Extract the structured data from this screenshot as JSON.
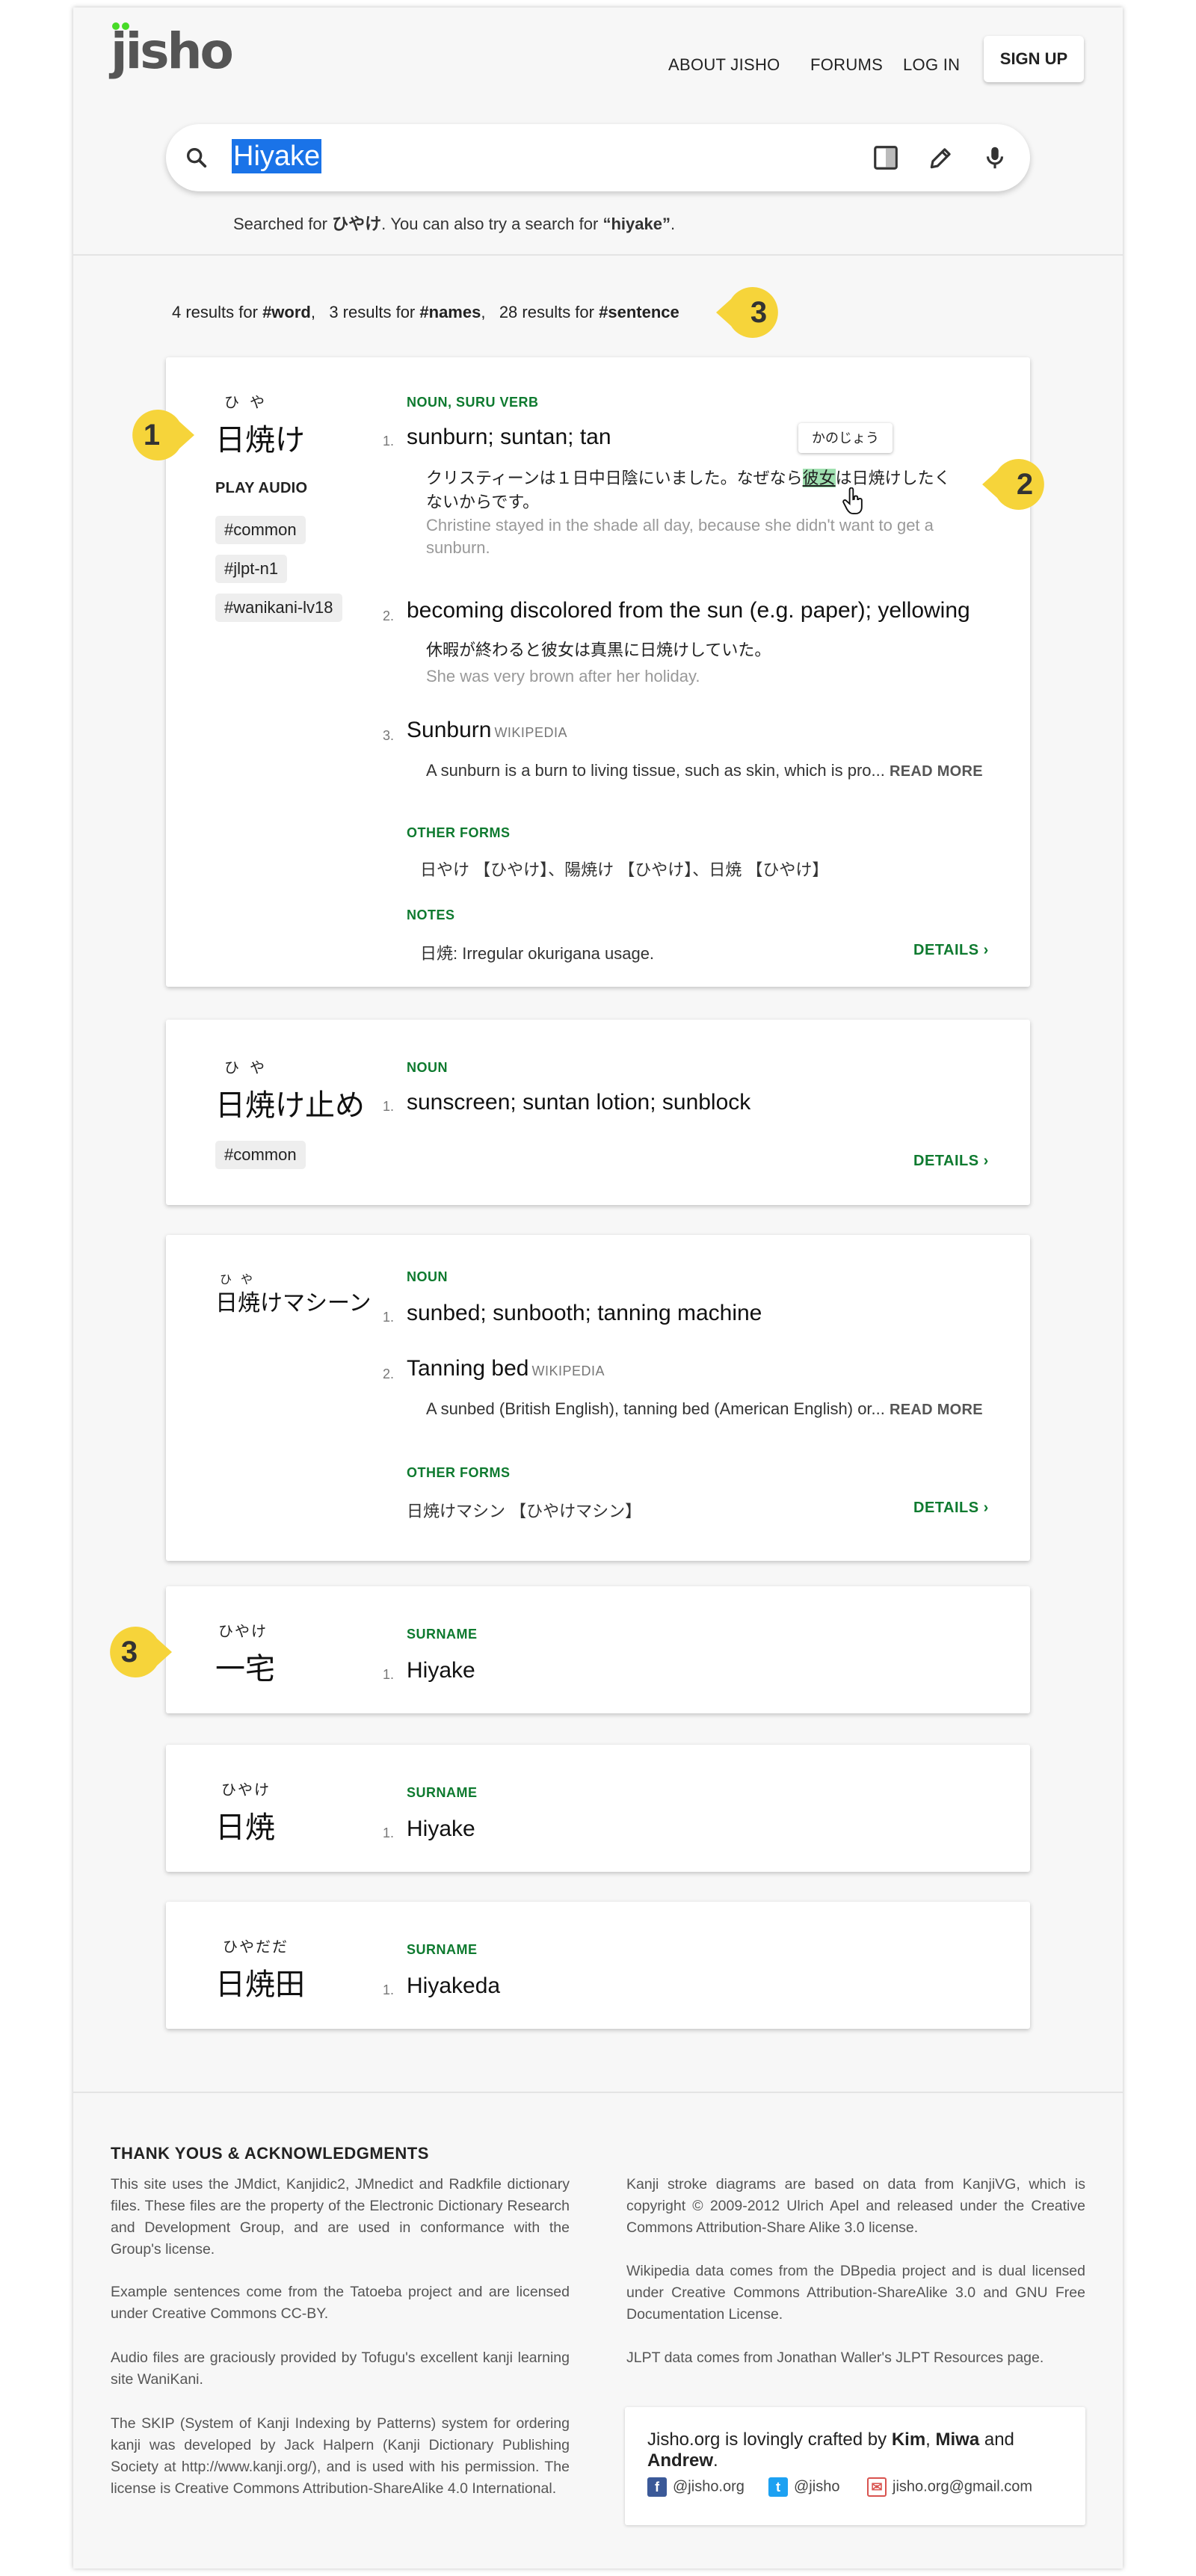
{
  "header": {
    "logo": "jisho",
    "nav": [
      "About Jisho",
      "Forums",
      "Log in"
    ],
    "signup": "SIGN UP"
  },
  "search": {
    "value": "Hiyake",
    "searched_prefix": "Searched for ",
    "searched_kana": "ひやけ",
    "searched_mid": ". You can also try a search for ",
    "searched_alt": "“hiyake”",
    "searched_end": "."
  },
  "results": {
    "word_count": "4 results for",
    "word_tag": "#word",
    "names_count": "3 results for",
    "names_tag": "#names",
    "sentence_count": "28 results for",
    "sentence_tag": "#sentence",
    "sep": ","
  },
  "badges": [
    "1",
    "2",
    "3",
    "3"
  ],
  "badge_color": "#f6d43a",
  "entries": [
    {
      "furigana": "ひや",
      "word": "日焼け",
      "play_audio": "PLAY AUDIO",
      "tags": [
        "#common",
        "#jlpt-n1",
        "#wanikani-lv18"
      ],
      "pos": "NOUN, SURU VERB",
      "senses": [
        {
          "num": "1.",
          "meaning": "sunburn; suntan; tan",
          "ja_line1_a": "クリスティーンは１日中日陰にいました。なぜなら",
          "ja_hl": "彼女",
          "ja_line1_b": "は日焼けしたく",
          "ja_line2": "ないからです。",
          "en": "Christine stayed in the shade all day, because she didn't want to get a sunburn."
        },
        {
          "num": "2.",
          "meaning": "becoming discolored from the sun (e.g. paper); yellowing",
          "ja": "休暇が終わると彼女は真黒に日焼けしていた。",
          "en": "She was very brown after her holiday."
        },
        {
          "num": "3.",
          "meaning": "Sunburn",
          "wiki": "WIKIPEDIA",
          "abstract": "A sunburn is a burn to living tissue, such as skin, which is pro...",
          "readmore": "READ MORE"
        }
      ],
      "tooltip": "かのじょう",
      "other_forms_label": "OTHER FORMS",
      "other_forms": "日やけ 【ひやけ】、陽焼け 【ひやけ】、日焼 【ひやけ】",
      "notes_label": "NOTES",
      "notes": "日焼: Irregular okurigana usage.",
      "details": "DETAILS"
    },
    {
      "furigana": "ひや",
      "word": "日焼け止め",
      "tags": [
        "#common"
      ],
      "pos": "NOUN",
      "senses": [
        {
          "num": "1.",
          "meaning": "sunscreen; suntan lotion; sunblock"
        }
      ],
      "details": "DETAILS"
    },
    {
      "furigana": "ひや",
      "word": "日焼けマシーン",
      "pos": "NOUN",
      "senses": [
        {
          "num": "1.",
          "meaning": "sunbed; sunbooth; tanning machine"
        },
        {
          "num": "2.",
          "meaning": "Tanning bed",
          "wiki": "WIKIPEDIA",
          "abstract": "A sunbed (British English), tanning bed (American English) or...",
          "readmore": "READ MORE"
        }
      ],
      "other_forms_label": "OTHER FORMS",
      "other_forms": "日焼けマシン 【ひやけマシン】",
      "details": "DETAILS"
    },
    {
      "furigana": "ひやけ",
      "word": "一宅",
      "pos": "SURNAME",
      "senses": [
        {
          "num": "1.",
          "meaning": "Hiyake"
        }
      ]
    },
    {
      "furigana": "ひやけ",
      "word": "日焼",
      "pos": "SURNAME",
      "senses": [
        {
          "num": "1.",
          "meaning": "Hiyake"
        }
      ]
    },
    {
      "furigana": "ひやだだ",
      "word": "日焼田",
      "pos": "SURNAME",
      "senses": [
        {
          "num": "1.",
          "meaning": "Hiyakeda"
        }
      ]
    }
  ],
  "footer": {
    "title": "THANK YOUS & ACKNOWLEDGMENTS",
    "left": [
      "This site uses the JMdict, Kanjidic2, JMnedict and Radkfile dictionary files. These files are the property of the Electronic Dictionary Research and Development Group, and are used in conformance with the Group's license.",
      "Example sentences come from the Tatoeba project and are licensed under Creative Commons CC-BY.",
      "Audio files are graciously provided by Tofugu's excellent kanji learning site WaniKani.",
      "The SKIP (System of Kanji Indexing by Patterns) system for ordering kanji was developed by Jack Halpern (Kanji Dictionary Publishing Society at http://www.kanji.org/), and is used with his permission. The license is Creative Commons Attribution-ShareAlike 4.0 International."
    ],
    "right": [
      "Kanji stroke diagrams are based on data from KanjiVG, which is copyright © 2009-2012 Ulrich Apel and released under the Creative Commons Attribution-Share Alike 3.0 license.",
      "Wikipedia data comes from the DBpedia project and is dual licensed under Creative Commons Attribution-ShareAlike 3.0 and GNU Free Documentation License.",
      "JLPT data comes from Jonathan Waller's JLPT Resources page."
    ],
    "credit_prefix": "Jisho.org is lovingly crafted by ",
    "credit_kim": "Kim",
    "credit_comma": ", ",
    "credit_miwa": "Miwa",
    "credit_and": " and ",
    "credit_andrew": "Andrew",
    "credit_end": ".",
    "facebook": "@jisho.org",
    "twitter": "@jisho",
    "email": "jisho.org@gmail.com"
  },
  "colors": {
    "accent_green": "#0e7a2f",
    "highlight": "#1a73e8",
    "badge": "#f6d43a"
  },
  "icons": [
    "search-icon",
    "split-panel-icon",
    "pencil-icon",
    "microphone-icon",
    "chevron-right-icon",
    "hand-cursor-icon",
    "facebook-icon",
    "twitter-icon",
    "mail-icon"
  ]
}
